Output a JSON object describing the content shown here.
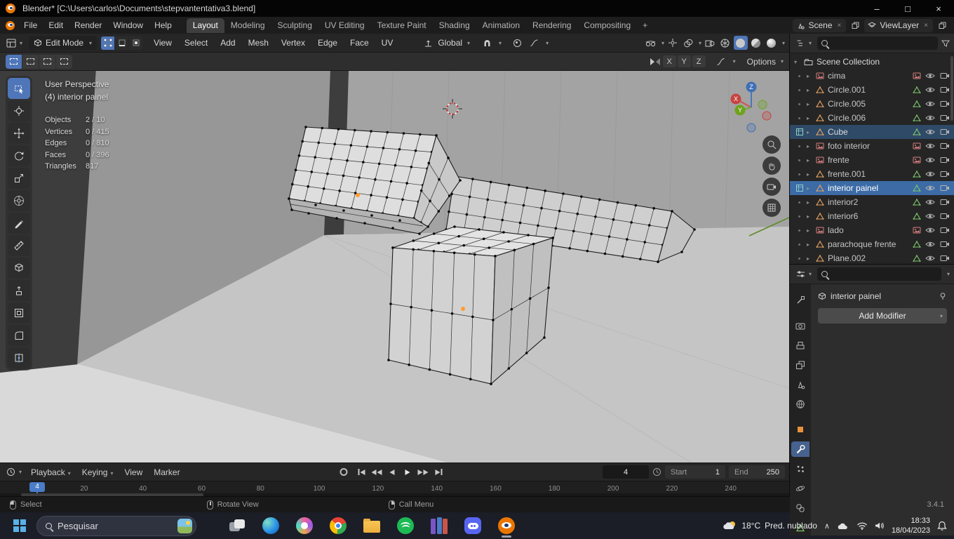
{
  "window": {
    "title": "Blender* [C:\\Users\\carlos\\Documents\\stepvantentativa3.blend]",
    "minimize": "–",
    "maximize": "□",
    "close": "×"
  },
  "topbar": {
    "menus": [
      "File",
      "Edit",
      "Render",
      "Window",
      "Help"
    ],
    "workspaces": [
      {
        "label": "Layout",
        "state": "active"
      },
      {
        "label": "Modeling"
      },
      {
        "label": "Sculpting"
      },
      {
        "label": "UV Editing"
      },
      {
        "label": "Texture Paint"
      },
      {
        "label": "Shading"
      },
      {
        "label": "Animation"
      },
      {
        "label": "Rendering"
      },
      {
        "label": "Compositing"
      }
    ],
    "add_workspace": "+",
    "scene_name": "Scene",
    "view_layer_name": "ViewLayer"
  },
  "view_header": {
    "mode": "Edit Mode",
    "menus": [
      "View",
      "Select",
      "Add",
      "Mesh",
      "Vertex",
      "Edge",
      "Face",
      "UV"
    ],
    "orientation": "Global",
    "right_icons": [
      "visibility-dropdown",
      "show-gizmo",
      "show-overlays",
      "toggle-xray",
      "shading-wireframe",
      "shading-solid",
      "shading-material",
      "shading-rendered"
    ],
    "active_shading": "solid"
  },
  "tool_settings": {
    "mirror_axes": [
      "X",
      "Y",
      "Z"
    ],
    "options_label": "Options"
  },
  "viewport": {
    "view_label": "User Perspective",
    "context_label": "(4) interior painel",
    "stats": [
      {
        "label": "Objects",
        "value": "2 / 10"
      },
      {
        "label": "Vertices",
        "value": "0 / 415"
      },
      {
        "label": "Edges",
        "value": "0 / 810"
      },
      {
        "label": "Faces",
        "value": "0 / 396"
      },
      {
        "label": "Triangles",
        "value": "817"
      }
    ],
    "axis_x": "X",
    "axis_y": "Y",
    "axis_z": "Z",
    "tools": [
      "select-box",
      "cursor",
      "move",
      "rotate",
      "scale",
      "transform",
      "annotate",
      "measure",
      "add-cube",
      "extrude-region",
      "inset-faces",
      "bevel",
      "loop-cut"
    ]
  },
  "outliner": {
    "root": "Scene Collection",
    "items": [
      {
        "name": "cima",
        "type": "image"
      },
      {
        "name": "Circle.001",
        "type": "mesh"
      },
      {
        "name": "Circle.005",
        "type": "mesh"
      },
      {
        "name": "Circle.006",
        "type": "mesh"
      },
      {
        "name": "Cube",
        "type": "mesh",
        "state": "selected",
        "edit": true
      },
      {
        "name": "foto interior",
        "type": "image"
      },
      {
        "name": "frente",
        "type": "image"
      },
      {
        "name": "frente.001",
        "type": "mesh"
      },
      {
        "name": "interior painel",
        "type": "mesh",
        "state": "active",
        "edit": true
      },
      {
        "name": "interior2",
        "type": "mesh"
      },
      {
        "name": "interior6",
        "type": "mesh"
      },
      {
        "name": "lado",
        "type": "image"
      },
      {
        "name": "parachoque frente",
        "type": "mesh"
      },
      {
        "name": "Plane.002",
        "type": "mesh"
      }
    ]
  },
  "properties": {
    "breadcrumb": "interior painel",
    "add_modifier_label": "Add Modifier",
    "tabs": [
      "tool",
      "render",
      "output",
      "view-layer",
      "scene",
      "world",
      "object",
      "modifiers",
      "particles",
      "physics",
      "constraints",
      "object-data"
    ],
    "active_tab": "modifiers"
  },
  "timeline": {
    "menus": [
      {
        "label": "Playback",
        "arrow": true
      },
      {
        "label": "Keying",
        "arrow": true
      },
      {
        "label": "View"
      },
      {
        "label": "Marker"
      }
    ],
    "transport": [
      "jump-to-start",
      "jump-to-prev-keyframe",
      "play-reverse",
      "play",
      "jump-to-next-keyframe",
      "jump-to-end"
    ],
    "current_frame": "4",
    "playhead": "4",
    "start_label": "Start",
    "start_value": "1",
    "end_label": "End",
    "end_value": "250",
    "ticks": [
      "20",
      "40",
      "60",
      "80",
      "100",
      "120",
      "140",
      "160",
      "180",
      "200",
      "220",
      "240"
    ]
  },
  "statusbar": {
    "hints": [
      {
        "label": "Select"
      },
      {
        "label": "Rotate View"
      },
      {
        "label": "Call Menu"
      }
    ],
    "version": "3.4.1"
  },
  "taskbar": {
    "search_label": "Pesquisar",
    "apps": [
      "task-view",
      "edge",
      "photos",
      "chrome",
      "file-explorer",
      "spotify",
      "winrar",
      "discord",
      "blender"
    ],
    "active_app": "blender",
    "weather_temp": "18°C",
    "weather_desc": "Pred. nublado",
    "time": "18:33",
    "date": "18/04/2023"
  }
}
